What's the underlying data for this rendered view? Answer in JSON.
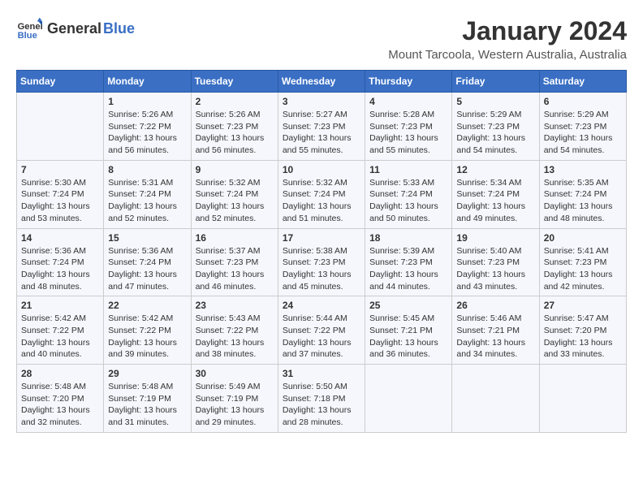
{
  "logo": {
    "text_general": "General",
    "text_blue": "Blue"
  },
  "title": "January 2024",
  "subtitle": "Mount Tarcoola, Western Australia, Australia",
  "columns": [
    "Sunday",
    "Monday",
    "Tuesday",
    "Wednesday",
    "Thursday",
    "Friday",
    "Saturday"
  ],
  "weeks": [
    [
      {
        "day": "",
        "info": ""
      },
      {
        "day": "1",
        "info": "Sunrise: 5:26 AM\nSunset: 7:22 PM\nDaylight: 13 hours\nand 56 minutes."
      },
      {
        "day": "2",
        "info": "Sunrise: 5:26 AM\nSunset: 7:23 PM\nDaylight: 13 hours\nand 56 minutes."
      },
      {
        "day": "3",
        "info": "Sunrise: 5:27 AM\nSunset: 7:23 PM\nDaylight: 13 hours\nand 55 minutes."
      },
      {
        "day": "4",
        "info": "Sunrise: 5:28 AM\nSunset: 7:23 PM\nDaylight: 13 hours\nand 55 minutes."
      },
      {
        "day": "5",
        "info": "Sunrise: 5:29 AM\nSunset: 7:23 PM\nDaylight: 13 hours\nand 54 minutes."
      },
      {
        "day": "6",
        "info": "Sunrise: 5:29 AM\nSunset: 7:23 PM\nDaylight: 13 hours\nand 54 minutes."
      }
    ],
    [
      {
        "day": "7",
        "info": "Sunrise: 5:30 AM\nSunset: 7:24 PM\nDaylight: 13 hours\nand 53 minutes."
      },
      {
        "day": "8",
        "info": "Sunrise: 5:31 AM\nSunset: 7:24 PM\nDaylight: 13 hours\nand 52 minutes."
      },
      {
        "day": "9",
        "info": "Sunrise: 5:32 AM\nSunset: 7:24 PM\nDaylight: 13 hours\nand 52 minutes."
      },
      {
        "day": "10",
        "info": "Sunrise: 5:32 AM\nSunset: 7:24 PM\nDaylight: 13 hours\nand 51 minutes."
      },
      {
        "day": "11",
        "info": "Sunrise: 5:33 AM\nSunset: 7:24 PM\nDaylight: 13 hours\nand 50 minutes."
      },
      {
        "day": "12",
        "info": "Sunrise: 5:34 AM\nSunset: 7:24 PM\nDaylight: 13 hours\nand 49 minutes."
      },
      {
        "day": "13",
        "info": "Sunrise: 5:35 AM\nSunset: 7:24 PM\nDaylight: 13 hours\nand 48 minutes."
      }
    ],
    [
      {
        "day": "14",
        "info": "Sunrise: 5:36 AM\nSunset: 7:24 PM\nDaylight: 13 hours\nand 48 minutes."
      },
      {
        "day": "15",
        "info": "Sunrise: 5:36 AM\nSunset: 7:24 PM\nDaylight: 13 hours\nand 47 minutes."
      },
      {
        "day": "16",
        "info": "Sunrise: 5:37 AM\nSunset: 7:23 PM\nDaylight: 13 hours\nand 46 minutes."
      },
      {
        "day": "17",
        "info": "Sunrise: 5:38 AM\nSunset: 7:23 PM\nDaylight: 13 hours\nand 45 minutes."
      },
      {
        "day": "18",
        "info": "Sunrise: 5:39 AM\nSunset: 7:23 PM\nDaylight: 13 hours\nand 44 minutes."
      },
      {
        "day": "19",
        "info": "Sunrise: 5:40 AM\nSunset: 7:23 PM\nDaylight: 13 hours\nand 43 minutes."
      },
      {
        "day": "20",
        "info": "Sunrise: 5:41 AM\nSunset: 7:23 PM\nDaylight: 13 hours\nand 42 minutes."
      }
    ],
    [
      {
        "day": "21",
        "info": "Sunrise: 5:42 AM\nSunset: 7:22 PM\nDaylight: 13 hours\nand 40 minutes."
      },
      {
        "day": "22",
        "info": "Sunrise: 5:42 AM\nSunset: 7:22 PM\nDaylight: 13 hours\nand 39 minutes."
      },
      {
        "day": "23",
        "info": "Sunrise: 5:43 AM\nSunset: 7:22 PM\nDaylight: 13 hours\nand 38 minutes."
      },
      {
        "day": "24",
        "info": "Sunrise: 5:44 AM\nSunset: 7:22 PM\nDaylight: 13 hours\nand 37 minutes."
      },
      {
        "day": "25",
        "info": "Sunrise: 5:45 AM\nSunset: 7:21 PM\nDaylight: 13 hours\nand 36 minutes."
      },
      {
        "day": "26",
        "info": "Sunrise: 5:46 AM\nSunset: 7:21 PM\nDaylight: 13 hours\nand 34 minutes."
      },
      {
        "day": "27",
        "info": "Sunrise: 5:47 AM\nSunset: 7:20 PM\nDaylight: 13 hours\nand 33 minutes."
      }
    ],
    [
      {
        "day": "28",
        "info": "Sunrise: 5:48 AM\nSunset: 7:20 PM\nDaylight: 13 hours\nand 32 minutes."
      },
      {
        "day": "29",
        "info": "Sunrise: 5:48 AM\nSunset: 7:19 PM\nDaylight: 13 hours\nand 31 minutes."
      },
      {
        "day": "30",
        "info": "Sunrise: 5:49 AM\nSunset: 7:19 PM\nDaylight: 13 hours\nand 29 minutes."
      },
      {
        "day": "31",
        "info": "Sunrise: 5:50 AM\nSunset: 7:18 PM\nDaylight: 13 hours\nand 28 minutes."
      },
      {
        "day": "",
        "info": ""
      },
      {
        "day": "",
        "info": ""
      },
      {
        "day": "",
        "info": ""
      }
    ]
  ]
}
